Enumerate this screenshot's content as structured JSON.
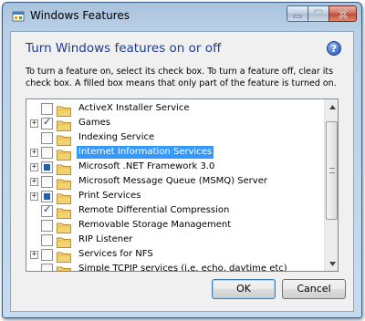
{
  "window": {
    "title": "Windows Features",
    "controls": {
      "minimize": "minimize",
      "maximize": "maximize",
      "close": "close"
    }
  },
  "dialog": {
    "heading": "Turn Windows features on or off",
    "description": "To turn a feature on, select its check box. To turn a feature off, clear its check box. A filled box means that only part of the feature is turned on.",
    "help": "?"
  },
  "features": [
    {
      "label": "ActiveX Installer Service",
      "expandable": false,
      "state": "unchecked",
      "selected": false
    },
    {
      "label": "Games",
      "expandable": true,
      "state": "checked",
      "selected": false
    },
    {
      "label": "Indexing Service",
      "expandable": false,
      "state": "unchecked",
      "selected": false
    },
    {
      "label": "Internet Information Services",
      "expandable": true,
      "state": "unchecked",
      "selected": true
    },
    {
      "label": "Microsoft .NET Framework 3.0",
      "expandable": true,
      "state": "partial",
      "selected": false
    },
    {
      "label": "Microsoft Message Queue (MSMQ) Server",
      "expandable": true,
      "state": "unchecked",
      "selected": false
    },
    {
      "label": "Print Services",
      "expandable": true,
      "state": "partial",
      "selected": false
    },
    {
      "label": "Remote Differential Compression",
      "expandable": false,
      "state": "checked",
      "selected": false
    },
    {
      "label": "Removable Storage Management",
      "expandable": false,
      "state": "unchecked",
      "selected": false
    },
    {
      "label": "RIP Listener",
      "expandable": false,
      "state": "unchecked",
      "selected": false
    },
    {
      "label": "Services for NFS",
      "expandable": true,
      "state": "unchecked",
      "selected": false
    },
    {
      "label": "Simple TCPIP services (i.e. echo, daytime etc)",
      "expandable": false,
      "state": "unchecked",
      "selected": false
    }
  ],
  "buttons": {
    "ok": "OK",
    "cancel": "Cancel"
  },
  "colors": {
    "heading": "#1e3c8c",
    "selection": "#3399ff",
    "partial_fill": "#2b5ca8"
  }
}
